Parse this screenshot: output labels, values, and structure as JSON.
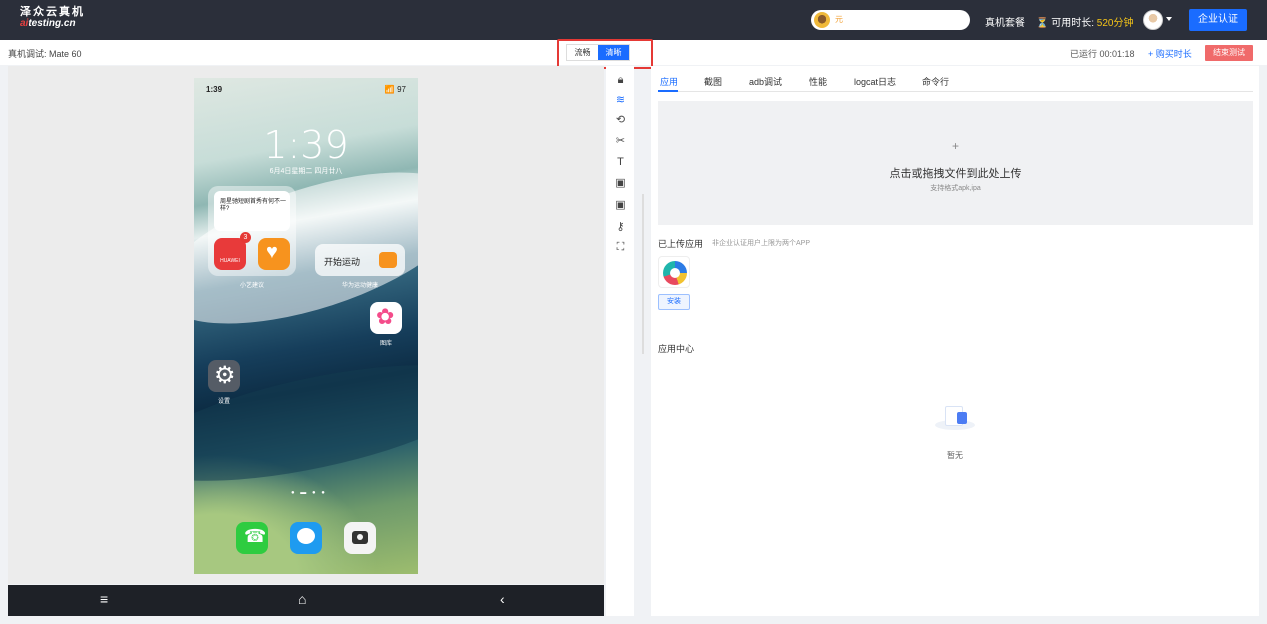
{
  "header": {
    "logo_line1": "泽众云真机",
    "logo_line2_prefix": "ai",
    "logo_line2_rest": "testing.cn",
    "user_name": "元",
    "plans": "真机套餐",
    "time_label": "可用时长:",
    "time_value": "520分钟",
    "cert_button": "企业认证"
  },
  "subheader": {
    "device_label": "真机调试: Mate 60",
    "quality_options": [
      "流畅",
      "清晰"
    ],
    "quality_selected": "清晰",
    "runtime": "已运行 00:01:18",
    "buy": "+ 购买时长",
    "end": "结束测试"
  },
  "phone": {
    "status_time": "1:39",
    "status_right": "📶 97",
    "clock": "1:39",
    "date": "6月4日星期二 四月廿八",
    "note_text": "周星驰短剧首秀有何不一样?",
    "app_huawei": "HUAWEI",
    "badge_count": "3",
    "label_xiaoyi": "小艺建议",
    "sport_text": "开始运动",
    "label_health": "华为运动健康",
    "label_gallery": "图库",
    "label_settings": "设置"
  },
  "tabs": [
    "应用",
    "截图",
    "adb调试",
    "性能",
    "logcat日志",
    "命令行"
  ],
  "upload": {
    "plus": "+",
    "title": "点击或拖拽文件到此处上传",
    "hint": "支持格式apk,ipa"
  },
  "uploaded_section": {
    "title": "已上传应用",
    "note": "非企业认证用户上限为两个APP",
    "install_button": "安装"
  },
  "app_center": {
    "title": "应用中心",
    "empty": "暂无"
  },
  "colors": {
    "accent": "#1a6cff",
    "topbar": "#2b2f3a",
    "danger": "#f06a6a",
    "highlight": "#f5c518"
  }
}
